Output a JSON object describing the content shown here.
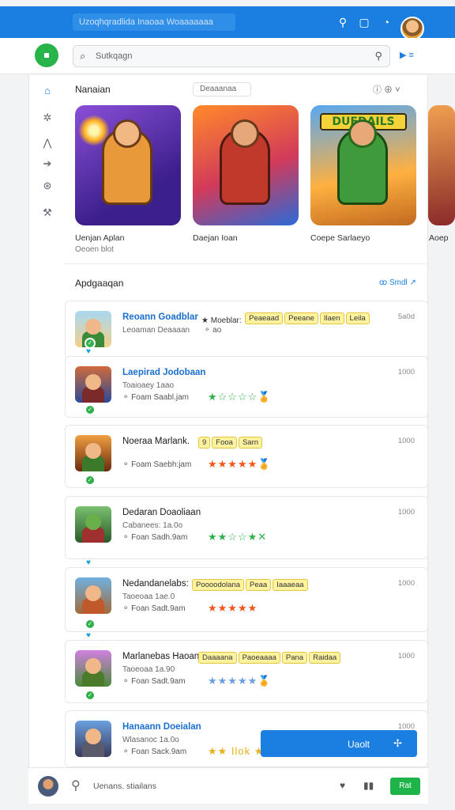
{
  "topbar": {
    "title": "Uzoqhqradlida Inaoaa Woaaaaaaa"
  },
  "header": {
    "search_placeholder": "Sutkqagn",
    "right_label": "▶ ≡"
  },
  "featured": {
    "title": "Nanaian",
    "chip": "Deaaanaa",
    "tools": "ⓘ  ⊕  ˅",
    "items": [
      {
        "name": "Uenjan Aplan",
        "sub": "Oeoen blot"
      },
      {
        "name": "Daejan Ioan",
        "sub": ""
      },
      {
        "name": "Coepe Sarlaeyo",
        "sub": "",
        "banner": "DUEDAILS"
      },
      {
        "name": "Aoep",
        "sub": ""
      }
    ]
  },
  "list": {
    "title": "Apdgaaqan",
    "link": "ꝏ Smdl ↗",
    "rows": [
      {
        "title": "Reoann Goadblar",
        "title_style": "blue",
        "sub": "Leoaman  Deaaaan",
        "meta": "⚬ ao",
        "stars": "",
        "time": "5a0d",
        "inline": "★ Moeblar:",
        "tags": [
          "Peaeaad",
          "Peeane",
          "Ilaen",
          "Leila"
        ]
      },
      {
        "title": "Laepirad Jodobaan",
        "title_style": "blue",
        "sub": "Toaioaey 1aao",
        "meta": "⚬ Foam  Saabl.jam",
        "stars": "★☆☆☆☆🏅",
        "time": "1000",
        "inline": "",
        "tags": []
      },
      {
        "title": "Noeraa Marlank.",
        "title_style": "",
        "sub": "",
        "meta": "⚬ Foam  Saebh:jam",
        "stars": "★★★★★🏅",
        "time": "1000",
        "inline": "",
        "tags": [
          "9",
          "Fooa",
          "Sarn"
        ]
      },
      {
        "title": "Dedaran Doaoliaan",
        "title_style": "",
        "sub": "Cabanees: 1a.0o",
        "meta": "⚬ Foan  Sadh.9am",
        "stars": "★★☆☆★✕",
        "time": "1000",
        "inline": "",
        "tags": []
      },
      {
        "title": "Nedandanelabs:",
        "title_style": "",
        "sub": "Taoeoaa 1ae.0",
        "meta": "⚬ Foan  Sadt.9am",
        "stars": "★★★★★",
        "time": "1000",
        "inline": "",
        "tags": [
          "Poooodolana",
          "Peaa",
          "Iaaaeaa"
        ]
      },
      {
        "title": "Marlanebas Haoan:",
        "title_style": "",
        "sub": "Taoeoaa 1a.90",
        "meta": "⚬ Foan  Sadt.9am",
        "stars": "★★★★★🏅",
        "time": "1000",
        "inline": "",
        "tags": [
          "Daaaana",
          "Paoeaaaa",
          "Pana",
          "Raidaa"
        ]
      },
      {
        "title": "Hanaann Doeialan",
        "title_style": "blue",
        "sub": "Wlasanoc 1a.0o",
        "meta": "⚬ Foan  Sack.9am",
        "stars": "★★ Ilok ★★",
        "time": "1000",
        "inline": "",
        "tags": []
      }
    ]
  },
  "cta": {
    "label": "Uaolt",
    "icon": "✢"
  },
  "bottombar": {
    "text": "Uenans. stiailans",
    "button": "Rat"
  },
  "colors": {
    "accent": "#1a7fe0",
    "green": "#1fb44a",
    "tag_bg": "#fff3a0"
  }
}
